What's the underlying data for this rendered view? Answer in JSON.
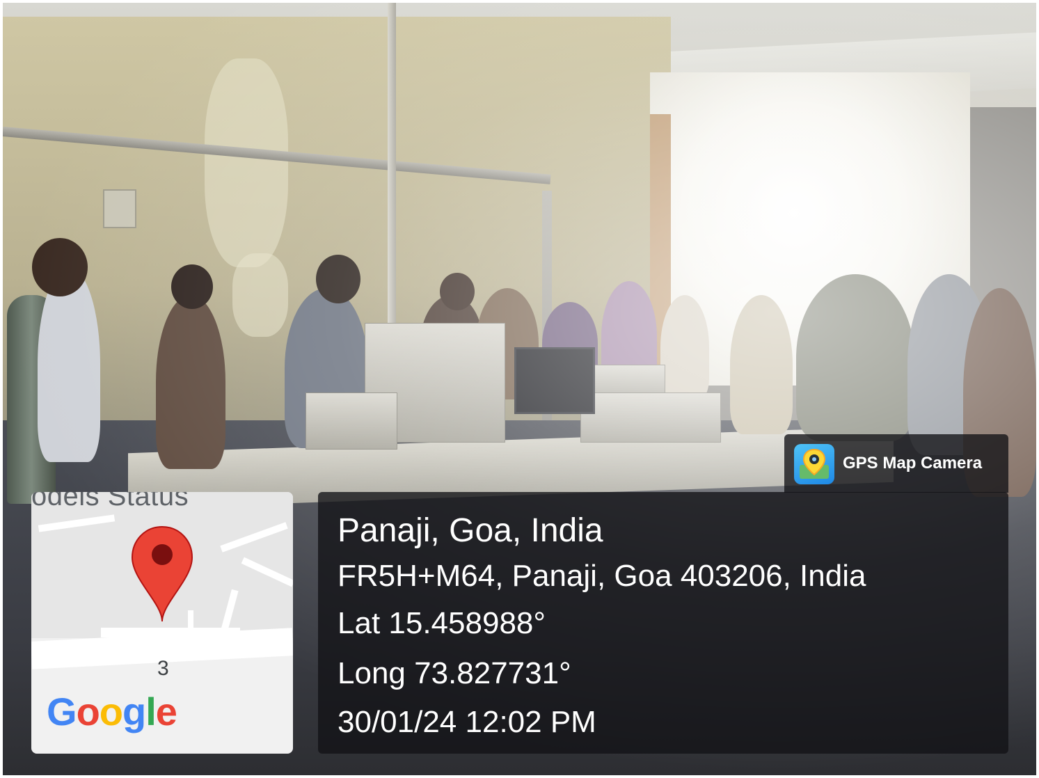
{
  "stamp": {
    "brand": "GPS Map Camera",
    "place": "Panaji, Goa, India",
    "address": "FR5H+M64, Panaji, Goa 403206, India",
    "latitude": "Lat 15.458988°",
    "longitude": "Long 73.827731°",
    "datetime": "30/01/24 12:02 PM"
  },
  "map": {
    "label_top": "odels Status",
    "number": "3",
    "logo_letters": [
      "G",
      "o",
      "o",
      "g",
      "l",
      "e"
    ],
    "logo_colors": [
      "#4285F4",
      "#EA4335",
      "#FBBC05",
      "#4285F4",
      "#34A853",
      "#EA4335"
    ],
    "pin_color": "#EA4335"
  },
  "icons": {
    "brand_icon": "gps-camera-icon",
    "map_pin": "map-pin-icon"
  }
}
